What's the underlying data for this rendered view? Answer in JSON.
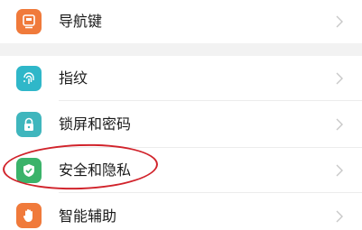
{
  "settings_list": {
    "items": [
      {
        "label": "导航键",
        "icon": "navigation-key-icon",
        "icon_color": "#f07a3b"
      },
      {
        "label": "指纹",
        "icon": "fingerprint-icon",
        "icon_color": "#2fb7c9"
      },
      {
        "label": "锁屏和密码",
        "icon": "lock-icon",
        "icon_color": "#3fb6bd"
      },
      {
        "label": "安全和隐私",
        "icon": "shield-check-icon",
        "icon_color": "#3bb36a"
      },
      {
        "label": "智能辅助",
        "icon": "hand-icon",
        "icon_color": "#f07a3b"
      }
    ],
    "highlight_color": "#d1232b"
  }
}
